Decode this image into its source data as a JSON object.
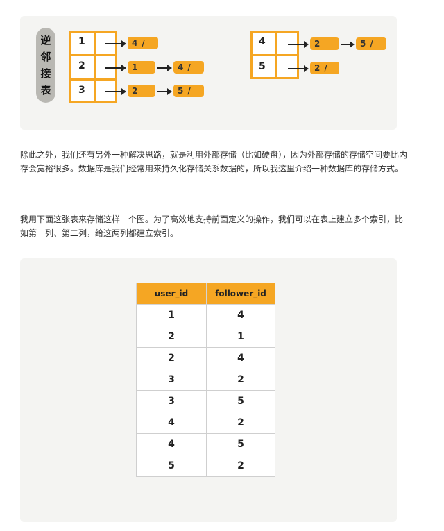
{
  "figure1": {
    "stamp_chars": [
      "逆",
      "邻",
      "接",
      "表"
    ],
    "left": {
      "rows": [
        {
          "key": "1",
          "nodes": [
            "4"
          ]
        },
        {
          "key": "2",
          "nodes": [
            "1",
            "4"
          ]
        },
        {
          "key": "3",
          "nodes": [
            "2",
            "5"
          ]
        }
      ]
    },
    "right": {
      "rows": [
        {
          "key": "4",
          "nodes": [
            "2",
            "5"
          ]
        },
        {
          "key": "5",
          "nodes": [
            "2"
          ]
        }
      ]
    }
  },
  "paragraphs": {
    "p1": "除此之外，我们还有另外一种解决思路，就是利用外部存储（比如硬盘），因为外部存储的存储空间要比内存会宽裕很多。数据库是我们经常用来持久化存储关系数据的，所以我这里介绍一种数据库的存储方式。",
    "p2": "我用下面这张表来存储这样一个图。为了高效地支持前面定义的操作，我们可以在表上建立多个索引，比如第一列、第二列，给这两列都建立索引。"
  },
  "table": {
    "headers": [
      "user_id",
      "follower_id"
    ],
    "rows": [
      [
        "1",
        "4"
      ],
      [
        "2",
        "1"
      ],
      [
        "2",
        "4"
      ],
      [
        "3",
        "2"
      ],
      [
        "3",
        "5"
      ],
      [
        "4",
        "2"
      ],
      [
        "4",
        "5"
      ],
      [
        "5",
        "2"
      ]
    ]
  },
  "colors": {
    "accent": "#f5a623",
    "panel_bg": "#f4f4f2"
  }
}
